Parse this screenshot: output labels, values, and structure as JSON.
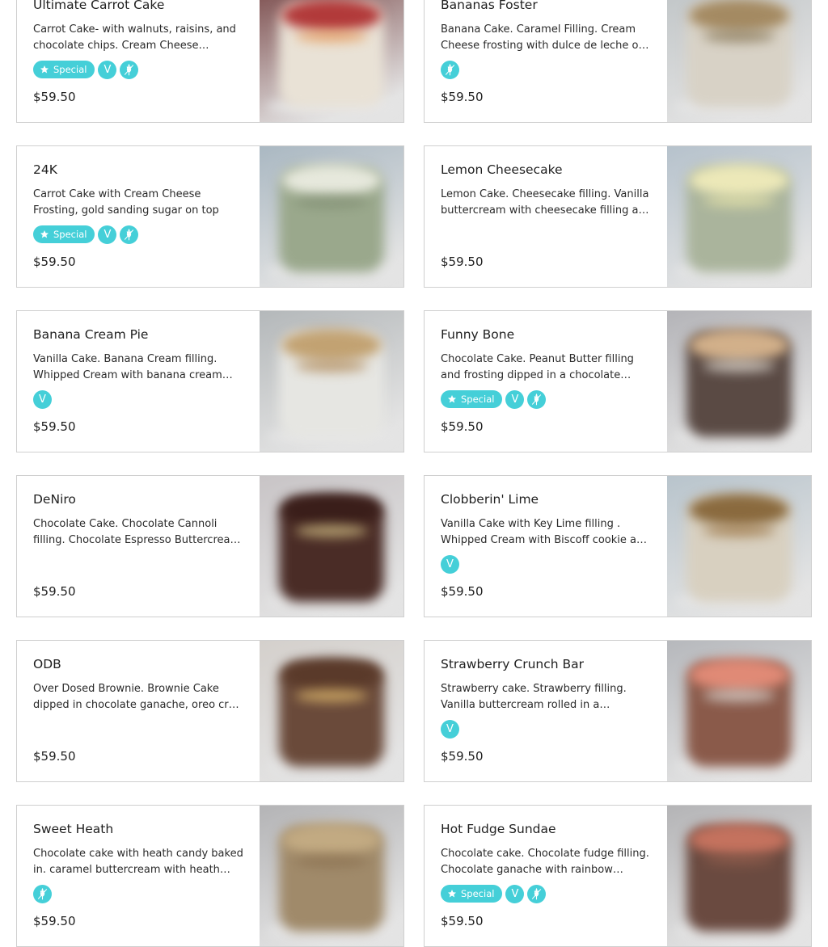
{
  "currency_note": "",
  "colors": {
    "accent": "#45cfd8",
    "border": "#cfcfcf",
    "text": "#1f1f1f"
  },
  "icons": {
    "special": "star-icon",
    "vegan": "v-letter-icon",
    "gluten_free": "wheat-slash-icon"
  },
  "badge_labels": {
    "special": "Special",
    "vegan": "V"
  },
  "products": [
    {
      "name": "Ultimate Carrot Cake",
      "description": "Carrot Cake- with walnuts, raisins, and chocolate chips. Cream Cheese frosting.",
      "price": "$59.50",
      "badges": [
        "special",
        "vegan",
        "gluten_free"
      ],
      "photo_colors": {
        "bg": "#7a4a4a",
        "cake": "#e9e2d6",
        "top": "#b23a3a",
        "accent": "#e8a060"
      }
    },
    {
      "name": "Bananas Foster",
      "description": "Banana Cake. Caramel Filling. Cream Cheese frosting with dulce de leche on top.",
      "price": "$59.50",
      "badges": [
        "gluten_free"
      ],
      "photo_colors": {
        "bg": "#bfc4c6",
        "cake": "#d8d2c6",
        "top": "#a48a62",
        "accent": "#8a7a5a"
      }
    },
    {
      "name": "24K",
      "description": "Carrot Cake with Cream Cheese Frosting, gold sanding sugar on top",
      "price": "$59.50",
      "badges": [
        "special",
        "vegan",
        "gluten_free"
      ],
      "photo_colors": {
        "bg": "#aab8c2",
        "cake": "#9aa88c",
        "top": "#e6e8dc",
        "accent": "#7e8c70"
      }
    },
    {
      "name": "Lemon Cheesecake",
      "description": "Lemon Cake. Cheesecake filling. Vanilla buttercream with cheesecake filling and lemon curd.",
      "price": "$59.50",
      "badges": [],
      "photo_colors": {
        "bg": "#b6c2cc",
        "cake": "#aab49c",
        "top": "#ece8b8",
        "accent": "#e2e0a8"
      }
    },
    {
      "name": "Banana Cream Pie",
      "description": "Vanilla Cake. Banana Cream filling. Whipped Cream with banana cream and wafers.",
      "price": "$59.50",
      "badges": [
        "vegan"
      ],
      "photo_colors": {
        "bg": "#b4b8ba",
        "cake": "#e6e6e2",
        "top": "#c2a272",
        "accent": "#b08a5a"
      }
    },
    {
      "name": "Funny Bone",
      "description": "Chocolate Cake. Peanut Butter filling and frosting dipped in a chocolate ganache.",
      "price": "$59.50",
      "badges": [
        "special",
        "vegan",
        "gluten_free"
      ],
      "photo_colors": {
        "bg": "#b4b4b8",
        "cake": "#5a4a44",
        "top": "#d2b08a",
        "accent": "#e2dcd4"
      }
    },
    {
      "name": "DeNiro",
      "description": "Chocolate Cake. Chocolate Cannoli filling. Chocolate Espresso Buttercream. Chocolate ganache drip.",
      "price": "$59.50",
      "badges": [],
      "photo_colors": {
        "bg": "#c8c4c6",
        "cake": "#4a2c26",
        "top": "#3a1e1a",
        "accent": "#d8c68a"
      }
    },
    {
      "name": "Clobberin' Lime",
      "description": "Vanilla Cake with Key Lime filling . Whipped Cream with Biscoff cookie and lime.",
      "price": "$59.50",
      "badges": [
        "vegan"
      ],
      "photo_colors": {
        "bg": "#b8c4cc",
        "cake": "#d8d0c0",
        "top": "#8a6a3e",
        "accent": "#a07a4a"
      }
    },
    {
      "name": "ODB",
      "description": "Over Dosed Brownie. Brownie Cake dipped in chocolate ganache, oreo crust and brownie bites.",
      "price": "$59.50",
      "badges": [],
      "photo_colors": {
        "bg": "#d4d0cc",
        "cake": "#6a4a3a",
        "top": "#5a3a2a",
        "accent": "#e6c070"
      }
    },
    {
      "name": "Strawberry Crunch Bar",
      "description": "Strawberry cake. Strawberry filling. Vanilla buttercream rolled in a strawberry crunch coating.",
      "price": "$59.50",
      "badges": [
        "vegan"
      ],
      "photo_colors": {
        "bg": "#b6b8bc",
        "cake": "#8a5a4a",
        "top": "#e08a76",
        "accent": "#dcdad6"
      }
    },
    {
      "name": "Sweet Heath",
      "description": "Chocolate cake with heath candy baked in. caramel buttercream with heath toffee pieces.",
      "price": "$59.50",
      "badges": [
        "gluten_free"
      ],
      "photo_colors": {
        "bg": "#b4b4b6",
        "cake": "#a08a6a",
        "top": "#c2aa82",
        "accent": "#8a7050"
      }
    },
    {
      "name": "Hot Fudge Sundae",
      "description": "Chocolate cake. Chocolate fudge filling. Chocolate ganache with rainbow sprinkles.",
      "price": "$59.50",
      "badges": [
        "special",
        "vegan",
        "gluten_free"
      ],
      "photo_colors": {
        "bg": "#b4b4b6",
        "cake": "#6a4a40",
        "top": "#c4725e",
        "accent": "#8a5a4a"
      }
    }
  ]
}
